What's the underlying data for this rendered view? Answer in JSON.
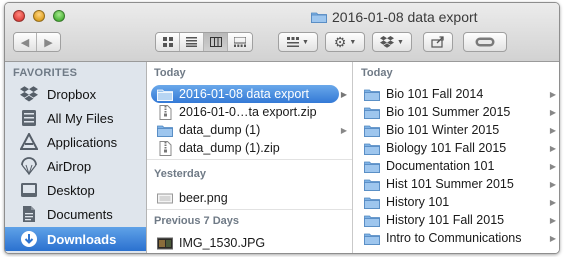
{
  "window": {
    "title": "2016-01-08 data export"
  },
  "toolbar": {
    "back_icon": "chevron-left-icon",
    "forward_icon": "chevron-right-icon",
    "view_modes": [
      "icon-view",
      "list-view",
      "column-view",
      "cover-flow-view"
    ],
    "active_view": "column-view"
  },
  "sidebar": {
    "heading": "FAVORITES",
    "items": [
      {
        "label": "Dropbox",
        "icon": "dropbox-icon"
      },
      {
        "label": "All My Files",
        "icon": "all-files-icon"
      },
      {
        "label": "Applications",
        "icon": "applications-icon"
      },
      {
        "label": "AirDrop",
        "icon": "airdrop-icon"
      },
      {
        "label": "Desktop",
        "icon": "desktop-icon"
      },
      {
        "label": "Documents",
        "icon": "documents-icon"
      },
      {
        "label": "Downloads",
        "icon": "downloads-icon",
        "selected": true
      }
    ]
  },
  "column1": {
    "sections": [
      {
        "heading": "Today"
      },
      {
        "heading": "Yesterday"
      },
      {
        "heading": "Previous 7 Days"
      }
    ],
    "rows": [
      {
        "label": "2016-01-08 data export",
        "type": "folder",
        "selected": true
      },
      {
        "label": "2016-01-0…ta export.zip",
        "type": "zip"
      },
      {
        "label": "data_dump (1)",
        "type": "folder"
      },
      {
        "label": "data_dump (1).zip",
        "type": "zip"
      },
      {
        "label": "beer.png",
        "type": "image"
      },
      {
        "label": "IMG_1530.JPG",
        "type": "photo"
      }
    ]
  },
  "column2": {
    "heading": "Today",
    "rows": [
      {
        "label": "Bio 101 Fall 2014"
      },
      {
        "label": "Bio 101 Summer 2015"
      },
      {
        "label": "Bio 101 Winter 2015"
      },
      {
        "label": "Biology 101 Fall 2015"
      },
      {
        "label": "Documentation 101"
      },
      {
        "label": "Hist 101 Summer 2015"
      },
      {
        "label": "History 101"
      },
      {
        "label": "History 101 Fall 2015"
      },
      {
        "label": "Intro to Communications"
      }
    ]
  },
  "colors": {
    "selection": "#3379d6",
    "sidebar_bg": "#dfe5ec",
    "folder": "#7fb2e5"
  }
}
